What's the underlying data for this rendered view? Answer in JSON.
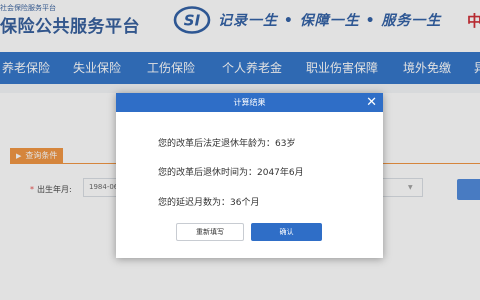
{
  "header": {
    "sub_title": "社会保险服务平台",
    "main_title": "保险公共服务平台",
    "logo_text": "SI",
    "slogan": "记录一生 • 保障一生 • 服务一生",
    "corner_text": "中"
  },
  "nav": {
    "items": [
      "养老保险",
      "失业保险",
      "工伤保险",
      "个人养老金",
      "职业伤害保障",
      "境外免缴",
      "异"
    ]
  },
  "form": {
    "query_tag": "查询条件",
    "birth_label": "出生年月:",
    "birth_value": "1984-06"
  },
  "modal": {
    "title": "计算结果",
    "close_symbol": "✕",
    "line1": "您的改革后法定退休年龄为：63岁",
    "line2": "您的改革后退休时间为：2047年6月",
    "line3": "您的延迟月数为：36个月",
    "reset_label": "重新填写",
    "ok_label": "确认"
  },
  "colors": {
    "nav_bg": "#1c66c3",
    "modal_header": "#2f6ec7",
    "query_tag": "#f08a2c",
    "brand_text": "#1f4e93"
  }
}
